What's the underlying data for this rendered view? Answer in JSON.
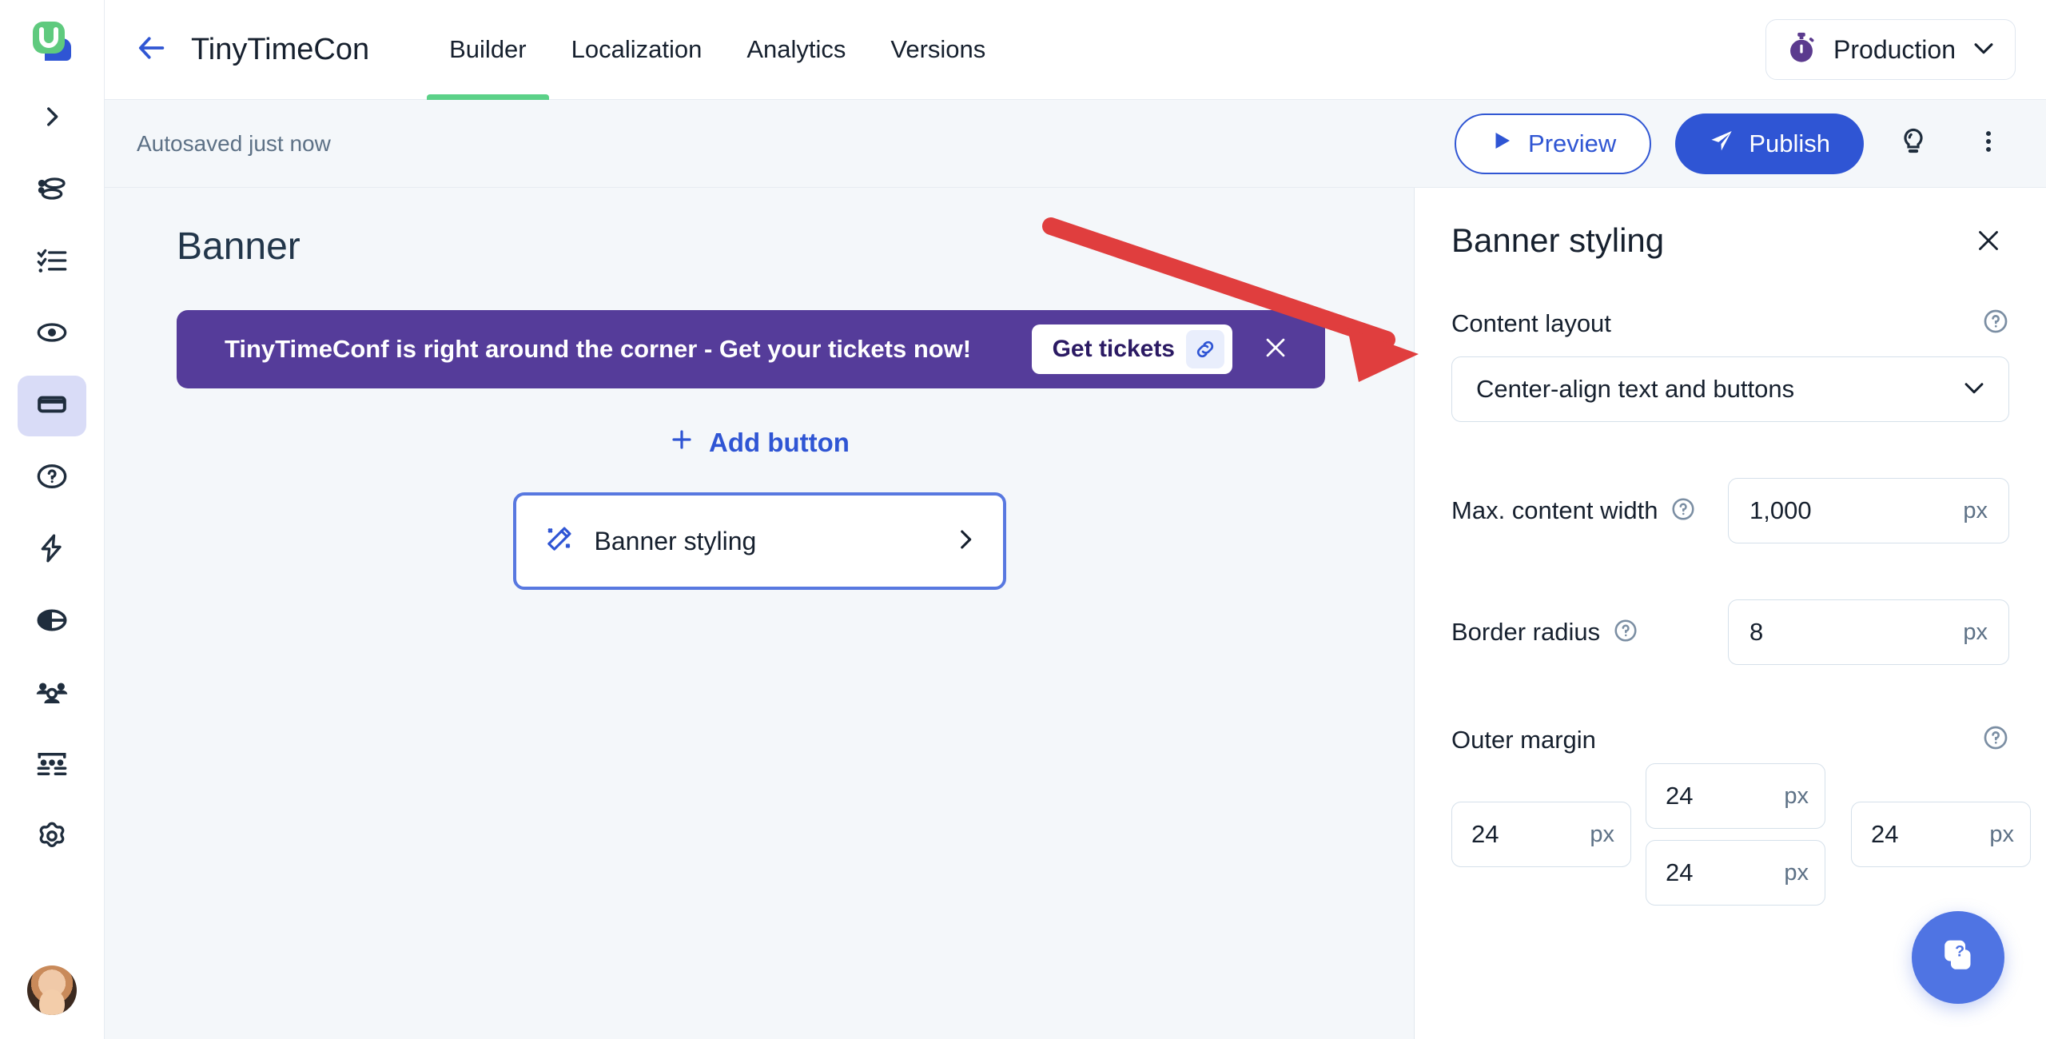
{
  "colors": {
    "accent_blue": "#2f55d4",
    "banner_purple": "#553c9a",
    "active_tab_underline": "#5bd188",
    "canvas_bg": "#f4f7fa",
    "annotation_red": "#e03e3e",
    "sidebar_active_bg": "#d9dcf7"
  },
  "sidebar": {
    "logo": "userguiding-logo",
    "items": [
      {
        "name": "expand-sidebar",
        "icon": "chevron-right-icon",
        "active": false
      },
      {
        "name": "guides",
        "icon": "guides-icon",
        "active": false
      },
      {
        "name": "checklists",
        "icon": "checklist-icon",
        "active": false
      },
      {
        "name": "hotspots",
        "icon": "hotspot-icon",
        "active": false
      },
      {
        "name": "banners",
        "icon": "banner-icon",
        "active": true
      },
      {
        "name": "resource-center",
        "icon": "question-circle-icon",
        "active": false
      },
      {
        "name": "automation",
        "icon": "lightning-bolt-icon",
        "active": false
      },
      {
        "name": "surveys",
        "icon": "pie-chart-icon",
        "active": false
      },
      {
        "name": "segments",
        "icon": "users-icon",
        "active": false
      },
      {
        "name": "product-analytics",
        "icon": "funnel-board-icon",
        "active": false
      },
      {
        "name": "settings",
        "icon": "gear-icon",
        "active": false
      }
    ],
    "avatar": "user-avatar"
  },
  "topbar": {
    "back_icon": "arrow-left-icon",
    "app_title": "TinyTimeCon",
    "tabs": [
      {
        "label": "Builder",
        "active": true
      },
      {
        "label": "Localization",
        "active": false
      },
      {
        "label": "Analytics",
        "active": false
      },
      {
        "label": "Versions",
        "active": false
      }
    ],
    "environment": {
      "icon": "stopwatch-icon",
      "label": "Production",
      "chevron": "chevron-down-icon"
    }
  },
  "actionbar": {
    "autosave_text": "Autosaved just now",
    "preview_label": "Preview",
    "preview_icon": "play-icon",
    "publish_label": "Publish",
    "publish_icon": "paper-plane-icon",
    "tips_icon": "lightbulb-icon",
    "more_icon": "more-vertical-icon"
  },
  "canvas": {
    "title": "Banner",
    "banner": {
      "message": "TinyTimeConf is right around the corner - Get your tickets now!",
      "cta_label": "Get tickets",
      "cta_link_icon": "link-icon",
      "close_icon": "close-icon"
    },
    "add_button_label": "Add button",
    "add_button_icon": "plus-icon",
    "styling_card": {
      "label": "Banner styling",
      "icon": "magic-wand-icon",
      "chevron": "chevron-right-icon"
    }
  },
  "panel": {
    "title": "Banner styling",
    "close_icon": "close-icon",
    "help_icon": "help-circle-icon",
    "content_layout": {
      "label": "Content layout",
      "value": "Center-align text and buttons",
      "chevron": "chevron-down-icon"
    },
    "max_content_width": {
      "label": "Max. content width",
      "value": "1,000",
      "unit": "px"
    },
    "border_radius": {
      "label": "Border radius",
      "value": "8",
      "unit": "px"
    },
    "outer_margin": {
      "label": "Outer margin",
      "top": "24",
      "left": "24",
      "right": "24",
      "bottom": "24",
      "unit": "px"
    }
  },
  "help_fab": {
    "icon": "resource-center-help-icon"
  }
}
